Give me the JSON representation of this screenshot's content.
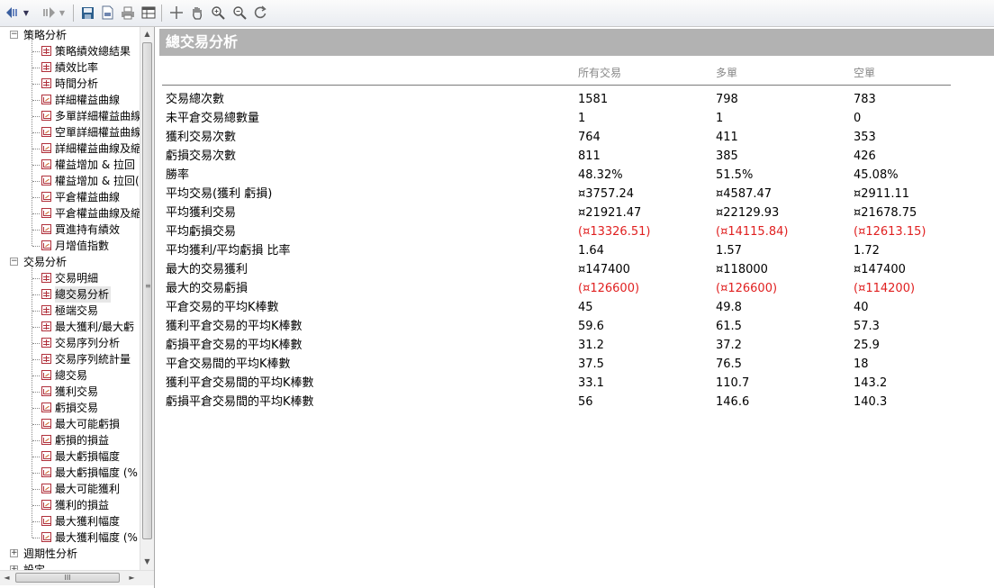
{
  "toolbar": {
    "buttons": [
      {
        "name": "back-icon"
      },
      {
        "name": "forward-icon"
      },
      {
        "name": "save-icon"
      },
      {
        "name": "export-pdf-icon"
      },
      {
        "name": "print-icon"
      },
      {
        "name": "table-view-icon"
      },
      {
        "name": "crosshair-icon"
      },
      {
        "name": "hand-pan-icon"
      },
      {
        "name": "zoom-in-icon"
      },
      {
        "name": "zoom-out-icon"
      },
      {
        "name": "refresh-icon"
      }
    ]
  },
  "sidebar": {
    "groups": [
      {
        "label": "策略分析",
        "expanded": true,
        "items": [
          {
            "label": "策略績效總結果",
            "icon": "table-icon"
          },
          {
            "label": "績效比率",
            "icon": "table-icon"
          },
          {
            "label": "時間分析",
            "icon": "table-icon"
          },
          {
            "label": "詳細權益曲線",
            "icon": "chart-icon"
          },
          {
            "label": "多單詳細權益曲線",
            "icon": "chart-icon"
          },
          {
            "label": "空單詳細權益曲線",
            "icon": "chart-icon"
          },
          {
            "label": "詳細權益曲線及縮",
            "icon": "chart-icon"
          },
          {
            "label": "權益增加 & 拉回",
            "icon": "chart-icon"
          },
          {
            "label": "權益增加 & 拉回(",
            "icon": "chart-icon"
          },
          {
            "label": "平倉權益曲線",
            "icon": "chart-icon"
          },
          {
            "label": "平倉權益曲線及縮",
            "icon": "chart-icon"
          },
          {
            "label": "買進持有績效",
            "icon": "chart-icon"
          },
          {
            "label": "月增值指數",
            "icon": "chart-icon"
          }
        ]
      },
      {
        "label": "交易分析",
        "expanded": true,
        "items": [
          {
            "label": "交易明細",
            "icon": "table-icon"
          },
          {
            "label": "總交易分析",
            "icon": "table-icon",
            "selected": true
          },
          {
            "label": "極端交易",
            "icon": "table-icon"
          },
          {
            "label": "最大獲利/最大虧",
            "icon": "table-icon"
          },
          {
            "label": "交易序列分析",
            "icon": "table-icon"
          },
          {
            "label": "交易序列統計量",
            "icon": "table-icon"
          },
          {
            "label": "總交易",
            "icon": "chart-icon"
          },
          {
            "label": "獲利交易",
            "icon": "chart-icon"
          },
          {
            "label": "虧損交易",
            "icon": "chart-icon"
          },
          {
            "label": "最大可能虧損",
            "icon": "chart-icon"
          },
          {
            "label": "虧損的損益",
            "icon": "chart-icon"
          },
          {
            "label": "最大虧損幅度",
            "icon": "chart-icon"
          },
          {
            "label": "最大虧損幅度 (%",
            "icon": "chart-icon"
          },
          {
            "label": "最大可能獲利",
            "icon": "chart-icon"
          },
          {
            "label": "獲利的損益",
            "icon": "chart-icon"
          },
          {
            "label": "最大獲利幅度",
            "icon": "chart-icon"
          },
          {
            "label": "最大獲利幅度 (%",
            "icon": "chart-icon"
          }
        ]
      },
      {
        "label": "週期性分析",
        "expanded": false,
        "items": []
      },
      {
        "label": "設定",
        "expanded": false,
        "items": [],
        "partial": true
      }
    ],
    "hscroll_grip": "III"
  },
  "main": {
    "title": "總交易分析",
    "columns": [
      "所有交易",
      "多單",
      "空單"
    ],
    "rows": [
      {
        "label": "交易總次數",
        "values": [
          "1581",
          "798",
          "783"
        ]
      },
      {
        "label": "未平倉交易總數量",
        "values": [
          "1",
          "1",
          "0"
        ]
      },
      {
        "label": "獲利交易次數",
        "values": [
          "764",
          "411",
          "353"
        ]
      },
      {
        "label": "虧損交易次數",
        "values": [
          "811",
          "385",
          "426"
        ]
      },
      {
        "label": "勝率",
        "values": [
          "48.32%",
          "51.5%",
          "45.08%"
        ]
      },
      {
        "label": "平均交易(獲利 虧損)",
        "values": [
          "¤3757.24",
          "¤4587.47",
          "¤2911.11"
        ]
      },
      {
        "label": "平均獲利交易",
        "values": [
          "¤21921.47",
          "¤22129.93",
          "¤21678.75"
        ]
      },
      {
        "label": "平均虧損交易",
        "values": [
          "(¤13326.51)",
          "(¤14115.84)",
          "(¤12613.15)"
        ],
        "negative": true
      },
      {
        "label": "平均獲利/平均虧損 比率",
        "values": [
          "1.64",
          "1.57",
          "1.72"
        ]
      },
      {
        "label": "最大的交易獲利",
        "values": [
          "¤147400",
          "¤118000",
          "¤147400"
        ]
      },
      {
        "label": "最大的交易虧損",
        "values": [
          "(¤126600)",
          "(¤126600)",
          "(¤114200)"
        ],
        "negative": true
      },
      {
        "label": "平倉交易的平均K棒數",
        "values": [
          "45",
          "49.8",
          "40"
        ]
      },
      {
        "label": "獲利平倉交易的平均K棒數",
        "values": [
          "59.6",
          "61.5",
          "57.3"
        ]
      },
      {
        "label": "虧損平倉交易的平均K棒數",
        "values": [
          "31.2",
          "37.2",
          "25.9"
        ]
      },
      {
        "label": "平倉交易間的平均K棒數",
        "values": [
          "37.5",
          "76.5",
          "18"
        ]
      },
      {
        "label": "獲利平倉交易間的平均K棒數",
        "values": [
          "33.1",
          "110.7",
          "143.2"
        ]
      },
      {
        "label": "虧損平倉交易間的平均K棒數",
        "values": [
          "56",
          "146.6",
          "140.3"
        ]
      }
    ]
  },
  "colors": {
    "negative": "#e02020",
    "header_bar": "#b2b2b2",
    "icon_accent": "#b0303b"
  }
}
